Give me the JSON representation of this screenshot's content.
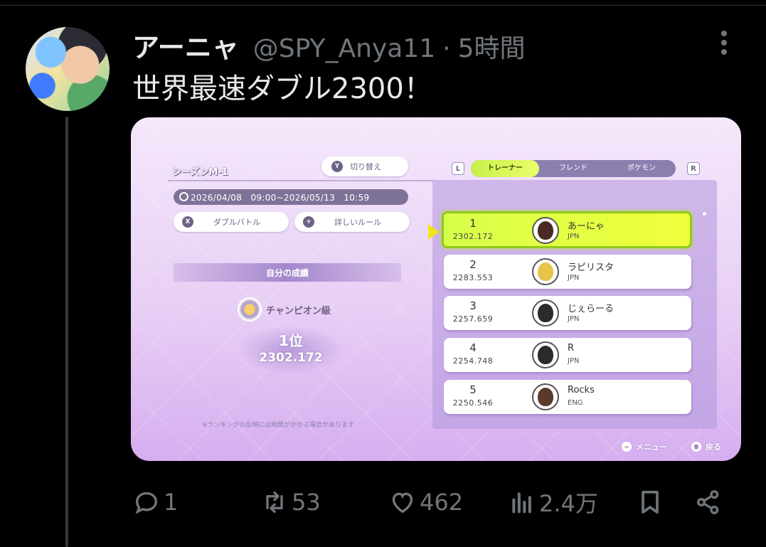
{
  "tweet": {
    "display_name": "アーニャ",
    "handle": "@SPY_Anya11",
    "separator": "·",
    "time": "5時間",
    "text": "世界最速ダブル2300！"
  },
  "game": {
    "season_title": "シーズンM-1",
    "switch_button": {
      "key": "Y",
      "label": "切り替え"
    },
    "period": "2026/04/08　09:00~2026/05/13　10:59",
    "battle_button": {
      "key": "X",
      "label": "ダブルバトル"
    },
    "rules_button": {
      "key": "+",
      "label": "詳しいルール"
    },
    "my_record_header": "自分の成績",
    "rank_class": "チャンピオン級",
    "my_rank": "1位",
    "my_score": "2302.172",
    "footnote": "※ランキングの反映には時間がかかる場合があります",
    "shoulder_left": "L",
    "shoulder_right": "R",
    "tabs": [
      "トレーナー",
      "フレンド",
      "ポケモン"
    ],
    "active_tab": "トレーナー",
    "rankings": [
      {
        "rank": "1",
        "score": "2302.172",
        "name": "あーにゃ",
        "country": "JPN",
        "hair": "#4a2a24"
      },
      {
        "rank": "2",
        "score": "2283.553",
        "name": "ラピリスタ",
        "country": "JPN",
        "hair": "#e8c34a"
      },
      {
        "rank": "3",
        "score": "2257.659",
        "name": "じぇらーる",
        "country": "JPN",
        "hair": "#2b2b2b"
      },
      {
        "rank": "4",
        "score": "2254.748",
        "name": "R",
        "country": "JPN",
        "hair": "#2b2b2b"
      },
      {
        "rank": "5",
        "score": "2250.546",
        "name": "Rocks",
        "country": "ENG",
        "hair": "#5a3a2a"
      }
    ],
    "footer_menu": {
      "key": "−",
      "label": "メニュー"
    },
    "footer_back": {
      "key": "B",
      "label": "戻る"
    }
  },
  "actions": {
    "reply_count": "1",
    "retweet_count": "53",
    "like_count": "462",
    "view_count": "2.4万"
  },
  "icons": [
    "reply-icon",
    "retweet-icon",
    "like-icon",
    "views-icon",
    "bookmark-icon",
    "share-icon",
    "more-icon"
  ],
  "colors": {
    "background": "#000000",
    "text": "#e7e9ea",
    "muted": "#71767b",
    "highlight_row": "#e6ff3c"
  }
}
